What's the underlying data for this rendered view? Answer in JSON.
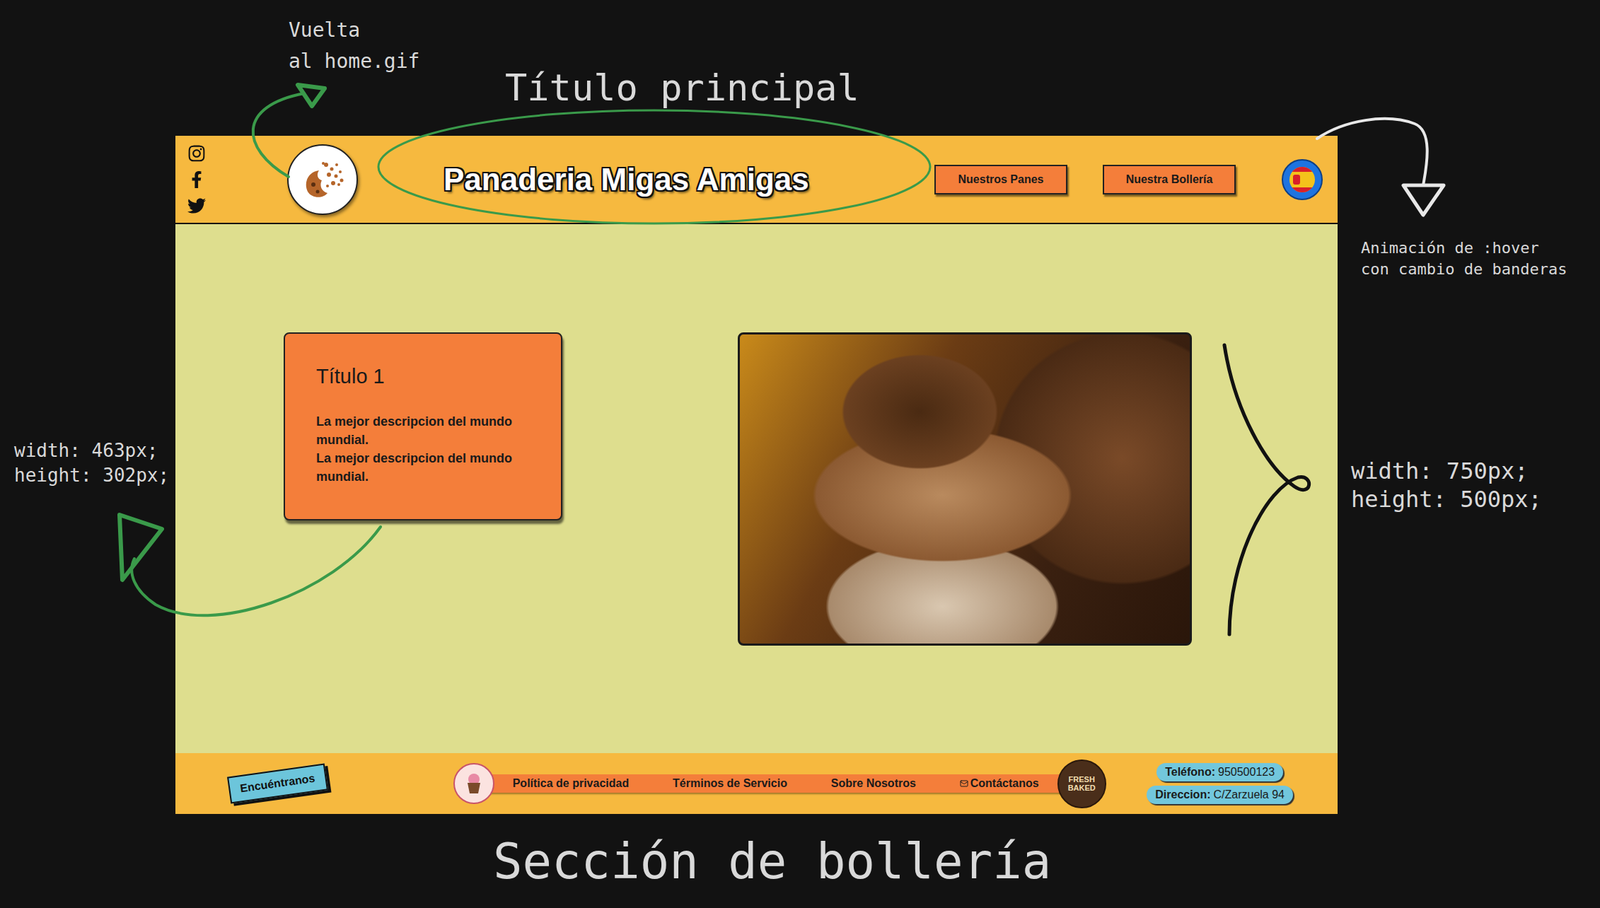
{
  "annotations": {
    "home_link": [
      "Vuelta",
      "al home.gif"
    ],
    "main_title": "Título principal",
    "flag_hover": [
      "Animación de :hover",
      "con cambio de banderas"
    ],
    "card_size": [
      "width: 463px;",
      "height: 302px;"
    ],
    "image_size": [
      "width: 750px;",
      "height: 500px;"
    ],
    "section": "Sección de bollería"
  },
  "header": {
    "title": "Panaderia Migas Amigas",
    "nav": [
      "Nuestros Panes",
      "Nuestra Bollería"
    ]
  },
  "card": {
    "title": "Título 1",
    "description": [
      "La mejor descripcion del mundo mundial.",
      "La mejor descripcion del mundo mundial."
    ]
  },
  "footer": {
    "find_us": "Encuéntranos",
    "links": [
      "Política de privacidad",
      "Términos de Servicio",
      "Sobre Nosotros",
      "Contáctanos"
    ],
    "badge": "FRESH BAKED",
    "contact": [
      {
        "label": "Teléfono:",
        "value": "950500123"
      },
      {
        "label": "Direccion:",
        "value": "C/Zarzuela 94"
      }
    ]
  }
}
